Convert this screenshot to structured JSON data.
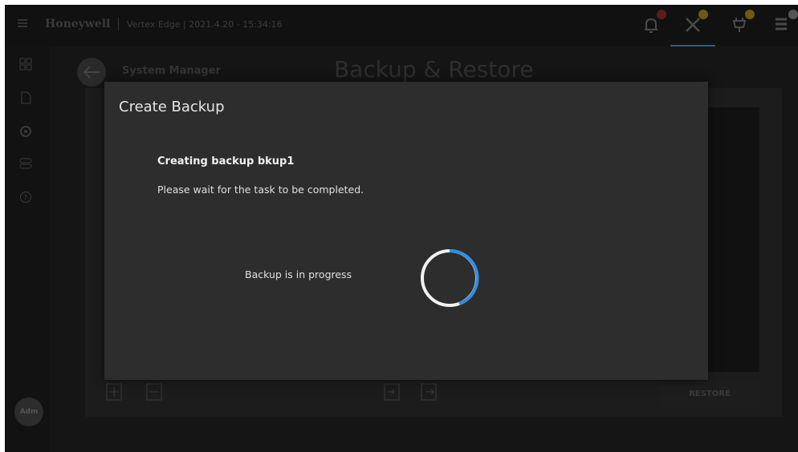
{
  "header": {
    "brand": "Honeywell",
    "subtitle": "Vertex Edge | 2021.4.20 - 15:34:16",
    "icons": [
      {
        "name": "bell-icon",
        "badge_color": "#c0392b"
      },
      {
        "name": "tools-icon",
        "badge_color": "#e0b000"
      },
      {
        "name": "plug-icon",
        "badge_color": "#e0b000"
      },
      {
        "name": "list-settings-icon",
        "badge_color": "#e0e0e0"
      }
    ]
  },
  "sidebar": {
    "icons": [
      "dashboard-icon",
      "document-icon",
      "gear-icon",
      "toggle-icon",
      "help-icon"
    ],
    "avatar_label": "Adm"
  },
  "page": {
    "breadcrumb": "System Manager",
    "title": "Backup & Restore",
    "restore_label": "RESTORE",
    "toolbar_icons": [
      "add-icon",
      "remove-icon",
      "import-icon",
      "export-icon"
    ]
  },
  "modal": {
    "title": "Create Backup",
    "status_title": "Creating backup bkup1",
    "status_message": "Please wait for the task to be completed.",
    "progress_label": "Backup is in progress"
  },
  "colors": {
    "accent": "#2f8fe0",
    "modal_bg": "#2d2d2d"
  }
}
